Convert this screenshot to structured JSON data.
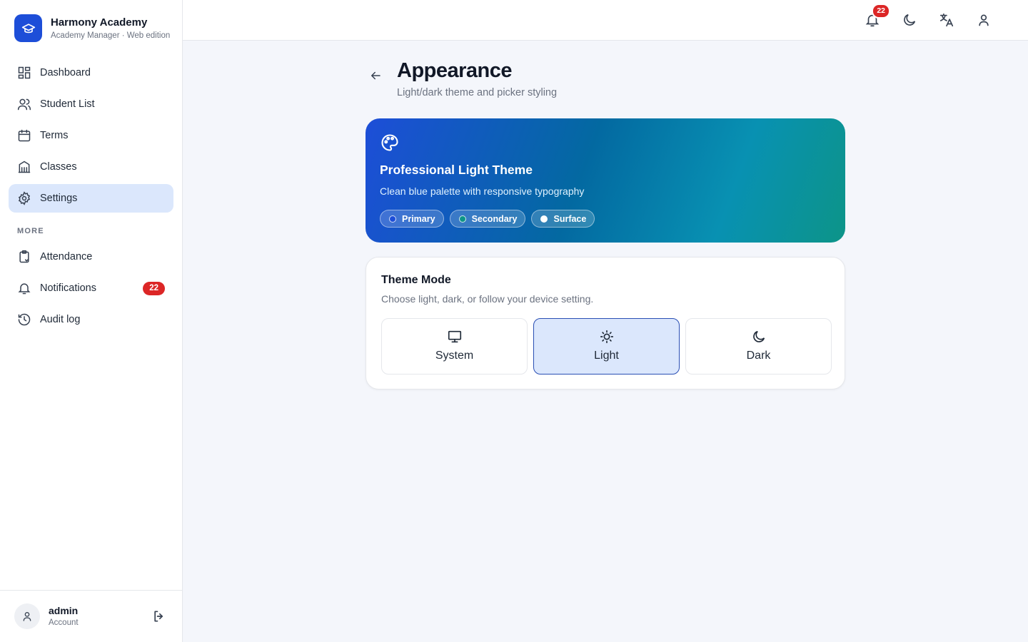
{
  "brand": {
    "title": "Harmony Academy",
    "subtitle": "Academy Manager · Web edition",
    "logo_icon": "graduation-cap-icon"
  },
  "sidebar": {
    "items": [
      {
        "label": "Dashboard",
        "icon": "dashboard-icon"
      },
      {
        "label": "Student List",
        "icon": "users-icon"
      },
      {
        "label": "Terms",
        "icon": "calendar-icon"
      },
      {
        "label": "Classes",
        "icon": "building-icon"
      },
      {
        "label": "Settings",
        "icon": "gear-icon",
        "active": true
      }
    ],
    "section_more": "MORE",
    "more_items": [
      {
        "label": "Attendance",
        "icon": "clipboard-icon"
      },
      {
        "label": "Notifications",
        "icon": "bell-icon",
        "badge": "22"
      },
      {
        "label": "Audit log",
        "icon": "history-icon"
      }
    ]
  },
  "footer": {
    "user_name": "admin",
    "user_role": "Account"
  },
  "topbar": {
    "notification_count": "22"
  },
  "page": {
    "title": "Appearance",
    "subtitle": "Light/dark theme and picker styling"
  },
  "hero": {
    "title": "Professional Light Theme",
    "subtitle": "Clean blue palette with responsive typography",
    "chips": [
      {
        "label": "Primary",
        "color": "#1d4ed8"
      },
      {
        "label": "Secondary",
        "color": "#0d9488"
      },
      {
        "label": "Surface",
        "color": "#ffffff"
      }
    ]
  },
  "theme_mode": {
    "title": "Theme Mode",
    "subtitle": "Choose light, dark, or follow your device setting.",
    "options": [
      {
        "label": "System",
        "icon": "monitor-icon"
      },
      {
        "label": "Light",
        "icon": "sun-icon",
        "selected": true
      },
      {
        "label": "Dark",
        "icon": "moon-icon"
      }
    ]
  },
  "colors": {
    "accent": "#1d4ed8",
    "active_bg": "#dbe7fc",
    "badge": "#dc2626"
  }
}
